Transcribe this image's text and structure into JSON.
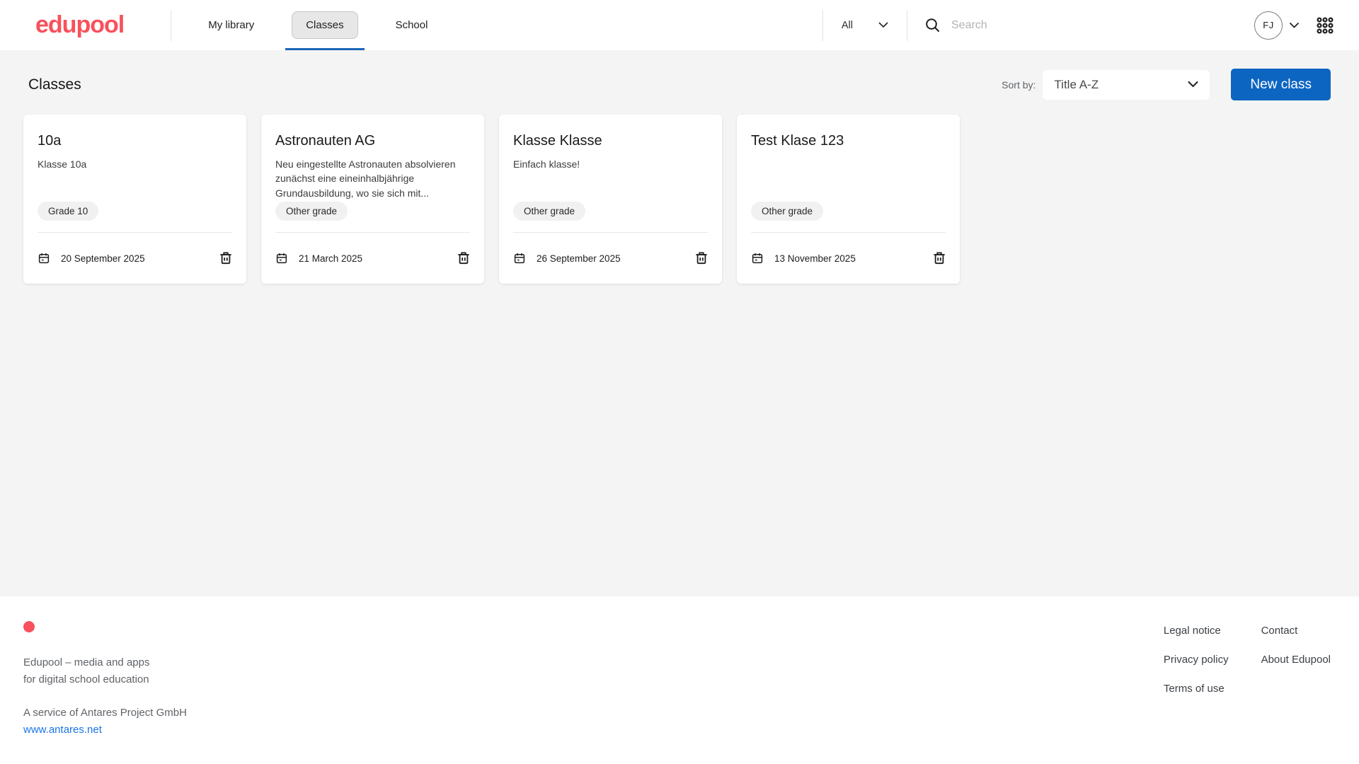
{
  "brand": {
    "logo_text": "edupool",
    "accent_red": "#f8515c",
    "accent_blue": "#0d65c2",
    "link_blue": "#1a73e8"
  },
  "header": {
    "nav": [
      {
        "label": "My library",
        "active": false
      },
      {
        "label": "Classes",
        "active": true
      },
      {
        "label": "School",
        "active": false
      }
    ],
    "filter_value": "All",
    "search_placeholder": "Search",
    "avatar_initials": "FJ"
  },
  "main": {
    "title": "Classes",
    "sort_label": "Sort by:",
    "sort_value": "Title A-Z",
    "new_class_button": "New class",
    "cards": [
      {
        "title": "10a",
        "description": "Klasse 10a",
        "badge": "Grade 10",
        "date": "20 September 2025"
      },
      {
        "title": "Astronauten AG",
        "description": "Neu eingestellte Astronauten absolvieren zunächst eine eineinhalbjährige Grundausbildung, wo sie sich mit...",
        "badge": "Other grade",
        "date": "21 March 2025"
      },
      {
        "title": "Klasse Klasse",
        "description": "Einfach klasse!",
        "badge": "Other grade",
        "date": "26 September 2025"
      },
      {
        "title": "Test Klase 123",
        "description": "",
        "badge": "Other grade",
        "date": "13 November 2025"
      }
    ]
  },
  "footer": {
    "tagline_line1": "Edupool – media and apps",
    "tagline_line2": "for digital school education",
    "service_line": "A service of Antares Project GmbH",
    "website": "www.antares.net",
    "links_col1": [
      "Legal notice",
      "Privacy policy",
      "Terms of use"
    ],
    "links_col2": [
      "Contact",
      "About Edupool"
    ]
  }
}
